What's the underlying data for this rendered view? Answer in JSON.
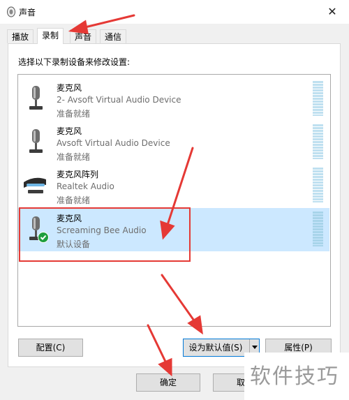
{
  "window": {
    "title": "声音",
    "close_label": "✕"
  },
  "tabs": [
    {
      "label": "播放"
    },
    {
      "label": "录制"
    },
    {
      "label": "声音"
    },
    {
      "label": "通信"
    }
  ],
  "instruction": "选择以下录制设备来修改设置:",
  "devices": [
    {
      "name": "麦克风",
      "desc": "2- Avsoft Virtual Audio Device",
      "status": "准备就绪",
      "selected": false
    },
    {
      "name": "麦克风",
      "desc": "Avsoft Virtual Audio Device",
      "status": "准备就绪",
      "selected": false
    },
    {
      "name": "麦克风阵列",
      "desc": "Realtek Audio",
      "status": "准备就绪",
      "selected": false
    },
    {
      "name": "麦克风",
      "desc": "Screaming Bee Audio",
      "status": "默认设备",
      "selected": true
    }
  ],
  "buttons": {
    "configure": "配置(C)",
    "set_default": "设为默认值(S)",
    "properties": "属性(P)",
    "ok": "确定",
    "cancel": "取消"
  },
  "watermark": "软件技巧",
  "colors": {
    "selection": "#cce8ff",
    "annotation": "#e53935",
    "default_check": "#1e9e3e"
  }
}
